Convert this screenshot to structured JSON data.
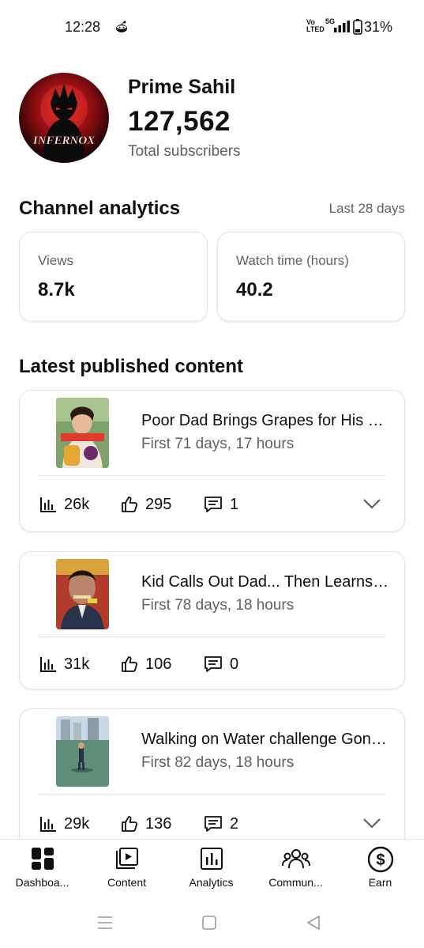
{
  "status_bar": {
    "time": "12:28",
    "volte_top": "Vo",
    "volte_bottom": "LTED",
    "network": "5G",
    "battery_pct": "31%"
  },
  "channel": {
    "name": "Prime Sahil",
    "subscribers": "127,562",
    "subscribers_label": "Total subscribers",
    "avatar_text": "INFERNOX"
  },
  "analytics": {
    "title": "Channel analytics",
    "range": "Last 28 days",
    "views_label": "Views",
    "views_value": "8.7k",
    "watch_label": "Watch time (hours)",
    "watch_value": "40.2"
  },
  "latest": {
    "title": "Latest published content",
    "videos": [
      {
        "title": "Poor Dad Brings Grapes for His Daughter",
        "meta": "First 71 days, 17 hours",
        "views": "26k",
        "likes": "295",
        "comments": "1",
        "has_expand": true
      },
      {
        "title": "Kid Calls Out Dad... Then Learns the Truth",
        "meta": "First 78 days, 18 hours",
        "views": "31k",
        "likes": "106",
        "comments": "0",
        "has_expand": false
      },
      {
        "title": "Walking on Water challenge Gone Wrong",
        "meta": "First 82 days, 18 hours",
        "views": "29k",
        "likes": "136",
        "comments": "2",
        "has_expand": true
      }
    ]
  },
  "bottom_nav": {
    "items": [
      {
        "label": "Dashboa...",
        "icon": "dashboard-icon",
        "active": true
      },
      {
        "label": "Content",
        "icon": "content-icon",
        "active": false
      },
      {
        "label": "Analytics",
        "icon": "analytics-icon",
        "active": false
      },
      {
        "label": "Commun...",
        "icon": "community-icon",
        "active": false
      },
      {
        "label": "Earn",
        "icon": "earn-icon",
        "active": false
      }
    ]
  },
  "colors": {
    "text_primary": "#0f0f0f",
    "text_secondary": "#606060",
    "avatar_red": "#c4121a"
  }
}
